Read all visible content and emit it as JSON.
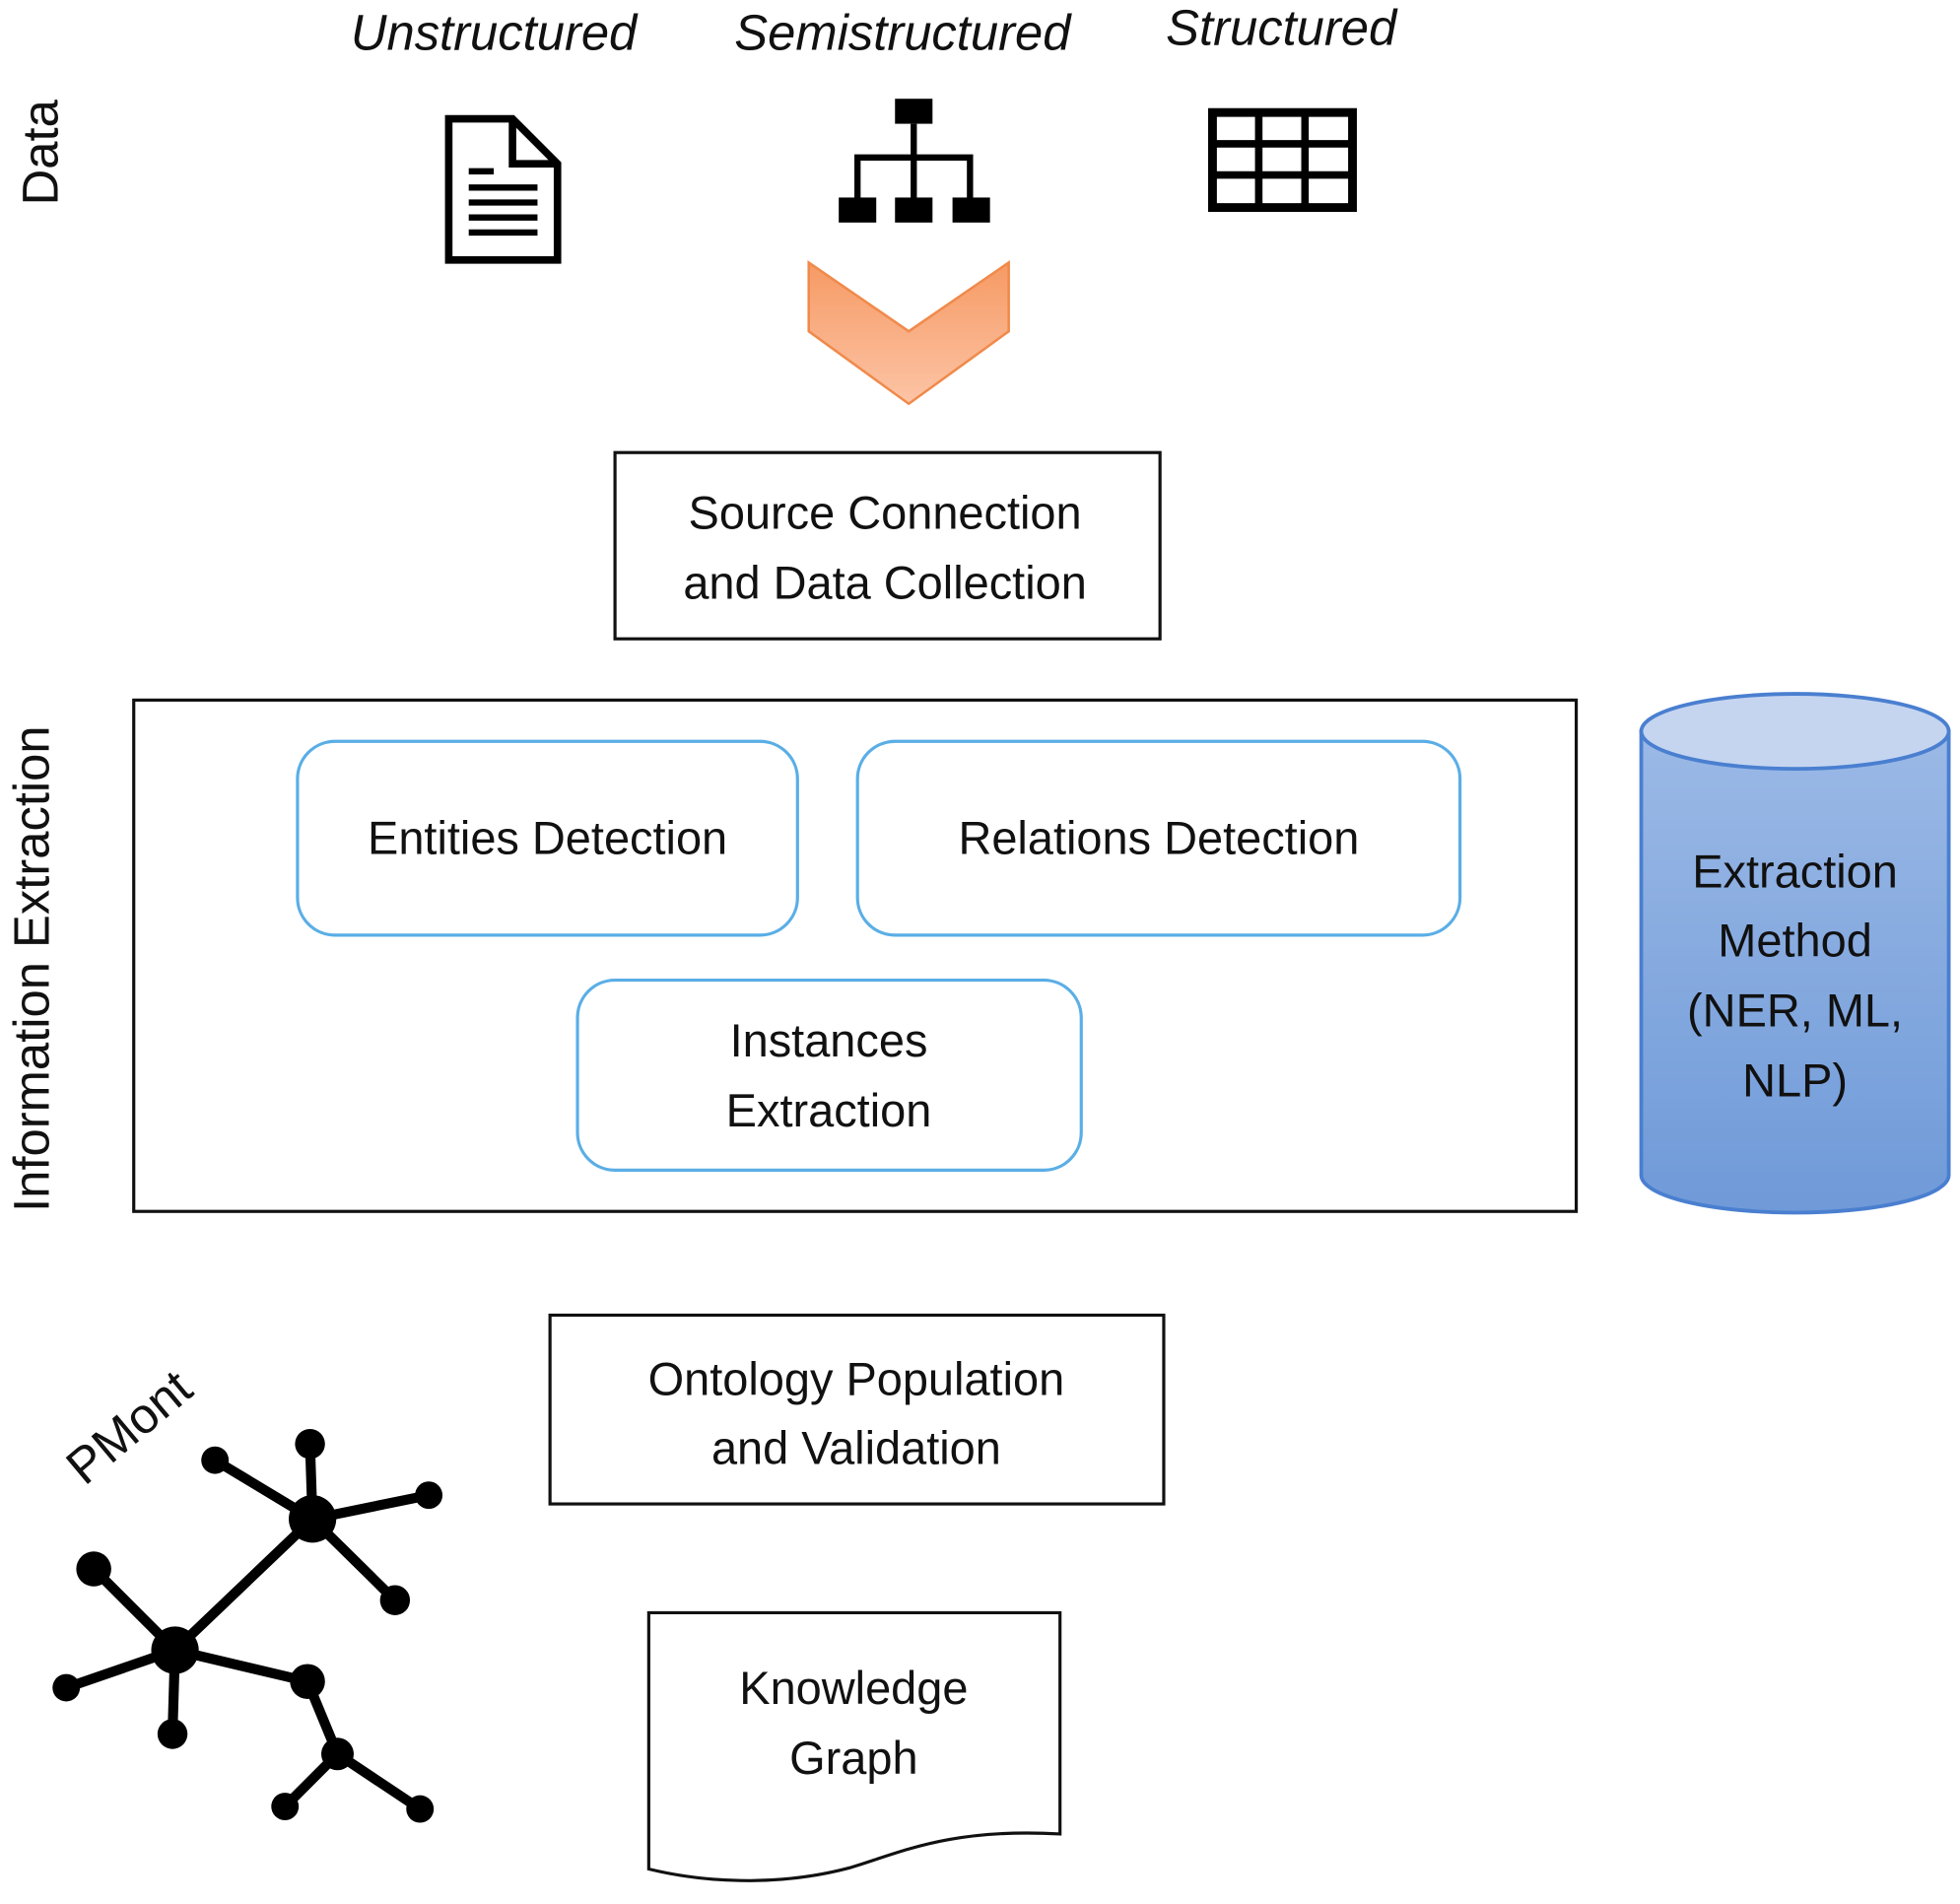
{
  "data_types": {
    "unstructured": "Unstructured",
    "semistructured": "Semistructured",
    "structured": "Structured"
  },
  "side_labels": {
    "data": "Data",
    "information_extraction": "Information Extraction",
    "pmont": "PMont"
  },
  "steps": {
    "source_connection": [
      "Source Connection",
      "and Data Collection"
    ],
    "entities_detection": "Entities Detection",
    "relations_detection": "Relations Detection",
    "instances_extraction": [
      "Instances",
      "Extraction"
    ],
    "ontology_population": [
      "Ontology Population",
      "and Validation"
    ],
    "knowledge_graph": [
      "Knowledge",
      "Graph"
    ]
  },
  "extraction_method": [
    "Extraction",
    "Method",
    "(NER, ML,",
    "NLP)"
  ],
  "icons": {
    "unstructured": "document-icon",
    "semistructured": "hierarchy-icon",
    "structured": "table-icon",
    "flow": "chevron-down-arrow",
    "method": "database-cylinder",
    "ontology": "network-graph-icon"
  },
  "colors": {
    "arrow_fill": "#f9a77a",
    "arrow_stroke": "#f08a4b",
    "rounded_box_stroke": "#5aaee6",
    "cylinder_fill": "#7fa6dd",
    "cylinder_top": "#c5d5f0",
    "cylinder_stroke": "#4a7fd0"
  }
}
